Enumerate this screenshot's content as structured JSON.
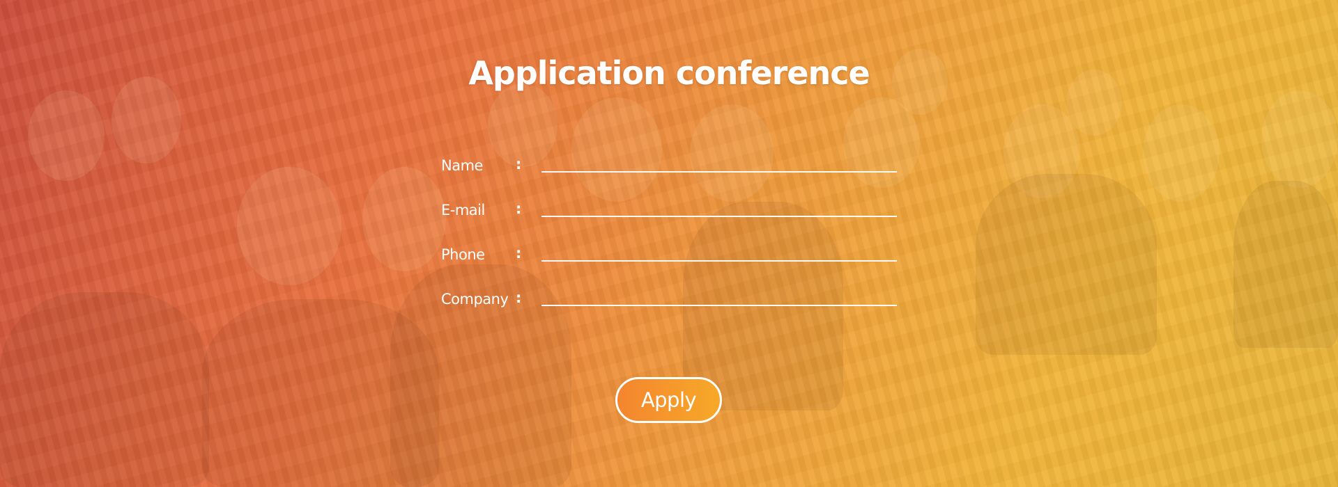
{
  "page": {
    "title": "Application conference"
  },
  "form": {
    "fields": [
      {
        "label": "Name",
        "separator": ":",
        "value": ""
      },
      {
        "label": "E-mail",
        "separator": ":",
        "value": ""
      },
      {
        "label": "Phone",
        "separator": ":",
        "value": ""
      },
      {
        "label": "Company",
        "separator": ":",
        "value": ""
      }
    ],
    "submit_label": "Apply"
  },
  "colors": {
    "gradient_start": "#cc4f3c",
    "gradient_mid": "#f09a3c",
    "gradient_end": "#f2b53a",
    "text": "#ffffff",
    "button_start": "#f4852f",
    "button_end": "#f7a928"
  }
}
